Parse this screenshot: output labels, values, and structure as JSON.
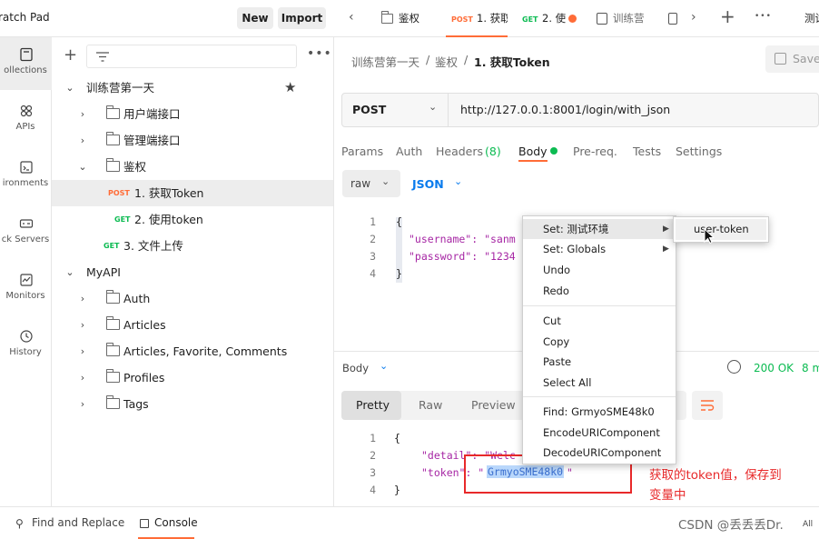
{
  "workspace": {
    "name": "ratch Pad",
    "new_label": "New",
    "import_label": "Import"
  },
  "rail": [
    {
      "label": "ollections",
      "icon": "collections-icon"
    },
    {
      "label": "APIs",
      "icon": "apis-icon"
    },
    {
      "label": "ironments",
      "icon": "environments-icon"
    },
    {
      "label": "ck Servers",
      "icon": "mock-servers-icon"
    },
    {
      "label": "Monitors",
      "icon": "monitors-icon"
    },
    {
      "label": "History",
      "icon": "history-icon"
    }
  ],
  "sidebar": {
    "tree": [
      {
        "label": "训练营第一天",
        "kind": "collection"
      },
      {
        "label": "用户端接口",
        "kind": "folder"
      },
      {
        "label": "管理端接口",
        "kind": "folder"
      },
      {
        "label": "鉴权",
        "kind": "folder"
      },
      {
        "label": "1. 获取Token",
        "kind": "request",
        "method": "POST"
      },
      {
        "label": "2. 使用token",
        "kind": "request",
        "method": "GET"
      },
      {
        "label": "3. 文件上传",
        "kind": "request",
        "method": "GET"
      },
      {
        "label": "MyAPI",
        "kind": "collection"
      },
      {
        "label": "Auth",
        "kind": "folder"
      },
      {
        "label": "Articles",
        "kind": "folder"
      },
      {
        "label": "Articles, Favorite, Comments",
        "kind": "folder"
      },
      {
        "label": "Profiles",
        "kind": "folder"
      },
      {
        "label": "Tags",
        "kind": "folder"
      }
    ]
  },
  "tabs": [
    {
      "label": "鉴权"
    },
    {
      "method": "POST",
      "label": "1. 获取"
    },
    {
      "method": "GET",
      "label": "2. 使"
    },
    {
      "label": "训练营"
    },
    {
      "label": "测试"
    }
  ],
  "request": {
    "breadcrumb": [
      "训练营第一天",
      "鉴权",
      "1. 获取Token"
    ],
    "save_label": "Save",
    "method": "POST",
    "url": "http://127.0.0.1:8001/login/with_json",
    "tabs": [
      "Params",
      "Auth",
      "Headers",
      "(8)",
      "Body",
      "Pre-req.",
      "Tests",
      "Settings"
    ],
    "body_mode": "raw",
    "body_lang": "JSON",
    "lines": [
      "{",
      "\"username\": \"sanm",
      "\"password\": \"1234",
      "}"
    ],
    "line_numbers": [
      "1",
      "2",
      "3",
      "4"
    ]
  },
  "response": {
    "label": "Body",
    "status": "200 OK",
    "time": "8 m",
    "view_tabs": [
      "Pretty",
      "Raw",
      "Preview"
    ],
    "lines": [
      "{",
      "\"detail\": \"Welc",
      "\"token\": \"GrmyoSME48k0\"",
      "}"
    ],
    "line_numbers": [
      "1",
      "2",
      "3",
      "4"
    ],
    "selected_text": "GrmyoSME48k0"
  },
  "context_menu": {
    "items": [
      "Set: 测试环境",
      "Set: Globals",
      "Undo",
      "Redo",
      "Cut",
      "Copy",
      "Paste",
      "Select All",
      "Find: GrmyoSME48k0",
      "EncodeURIComponent",
      "DecodeURIComponent"
    ],
    "submenu": [
      "user-token"
    ]
  },
  "annotation": {
    "line1": "获取的token值，保存到",
    "line2": "变量中",
    "color": "#e8292a"
  },
  "footer": {
    "find_replace": "Find and Replace",
    "console": "Console",
    "watermark": "CSDN @丢丢丢Dr.",
    "right": "All"
  },
  "colors": {
    "post": "#ff6c37",
    "get": "#0cbb52",
    "accent_blue": "#097bed",
    "active_orange": "#ff6c37"
  }
}
